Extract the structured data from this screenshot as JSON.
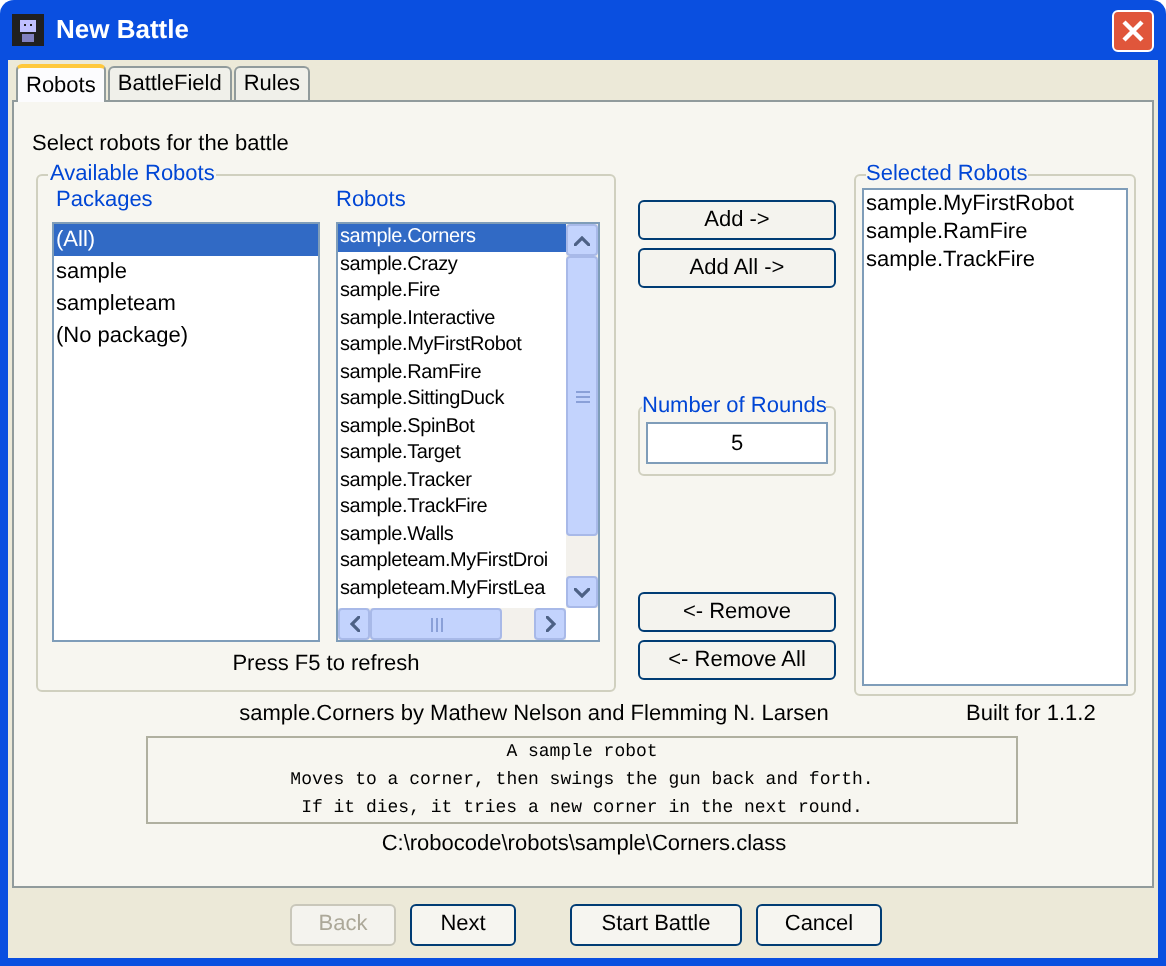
{
  "window": {
    "title": "New Battle"
  },
  "tabs": [
    {
      "label": "Robots",
      "selected": true
    },
    {
      "label": "BattleField",
      "selected": false
    },
    {
      "label": "Rules",
      "selected": false
    }
  ],
  "instruction": "Select robots for the battle",
  "available_robots": {
    "title": "Available Robots",
    "packages": {
      "label": "Packages",
      "items": [
        {
          "label": "(All)",
          "selected": true
        },
        {
          "label": "sample",
          "selected": false
        },
        {
          "label": "sampleteam",
          "selected": false
        },
        {
          "label": "(No package)",
          "selected": false
        }
      ]
    },
    "robots": {
      "label": "Robots",
      "items": [
        {
          "label": "sample.Corners",
          "selected": true
        },
        {
          "label": "sample.Crazy",
          "selected": false
        },
        {
          "label": "sample.Fire",
          "selected": false
        },
        {
          "label": "sample.Interactive",
          "selected": false
        },
        {
          "label": "sample.MyFirstRobot",
          "selected": false
        },
        {
          "label": "sample.RamFire",
          "selected": false
        },
        {
          "label": "sample.SittingDuck",
          "selected": false
        },
        {
          "label": "sample.SpinBot",
          "selected": false
        },
        {
          "label": "sample.Target",
          "selected": false
        },
        {
          "label": "sample.Tracker",
          "selected": false
        },
        {
          "label": "sample.TrackFire",
          "selected": false
        },
        {
          "label": "sample.Walls",
          "selected": false
        },
        {
          "label": "sampleteam.MyFirstDroi",
          "selected": false
        },
        {
          "label": "sampleteam.MyFirstLea",
          "selected": false
        }
      ]
    },
    "hint": "Press F5 to refresh"
  },
  "add_buttons": [
    "Add ->",
    "Add All ->"
  ],
  "rounds": {
    "label": "Number of Rounds",
    "value": "5"
  },
  "remove_buttons": [
    "<- Remove",
    "<- Remove All"
  ],
  "selected_robots": {
    "title": "Selected Robots",
    "items": [
      {
        "label": "sample.MyFirstRobot",
        "selected": false
      },
      {
        "label": "sample.RamFire",
        "selected": false
      },
      {
        "label": "sample.TrackFire",
        "selected": false
      }
    ]
  },
  "robot_info": {
    "author": "sample.Corners by Mathew Nelson and Flemming N. Larsen",
    "built_for": "Built for 1.1.2",
    "description": [
      "A sample robot",
      "Moves to a corner, then swings the gun back and forth.",
      "If it dies, it tries a new corner in the next round."
    ],
    "path": "C:\\robocode\\robots\\sample\\Corners.class"
  },
  "footer_buttons": [
    {
      "label": "Back",
      "disabled": true
    },
    {
      "label": "Next",
      "disabled": false
    },
    {
      "label": "Start Battle",
      "disabled": false
    },
    {
      "label": "Cancel",
      "disabled": false
    }
  ]
}
